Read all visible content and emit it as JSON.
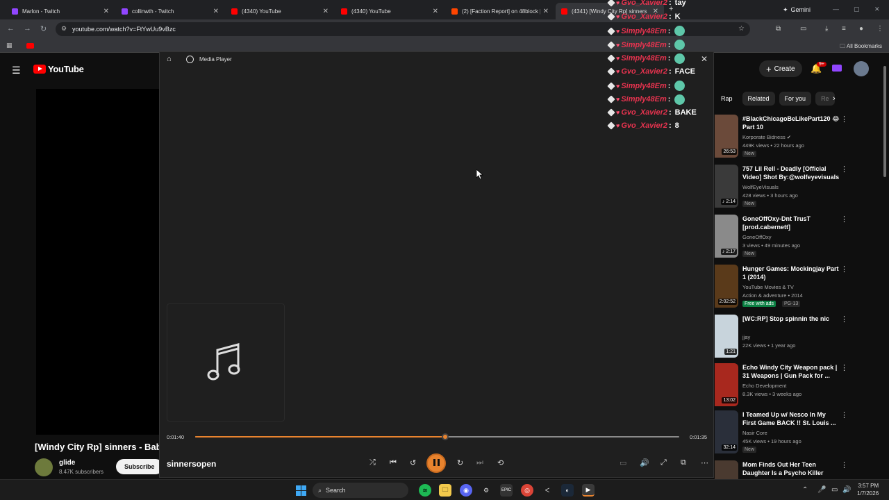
{
  "browser": {
    "tabs": [
      {
        "label": "Marlon - Twitch",
        "icon": "twitch-icon",
        "color": "#9146ff"
      },
      {
        "label": "collinwth - Twitch",
        "icon": "twitch-icon",
        "color": "#9146ff"
      },
      {
        "label": "(4340) YouTube",
        "icon": "youtube-icon",
        "color": "#ff0000"
      },
      {
        "label": "(4340) YouTube",
        "icon": "youtube-icon",
        "color": "#ff0000"
      },
      {
        "label": "(2) [Faction Report] on 48block |",
        "icon": "reddit-icon",
        "color": "#ff4500"
      },
      {
        "label": "(4341) [Windy City Rp] sinners",
        "icon": "youtube-icon",
        "color": "#ff0000"
      }
    ],
    "new_tab": "+",
    "gemini_label": "Gemini",
    "url": "youtube.com/watch?v=FtYwUu9vBzc",
    "all_bookmarks": "All Bookmarks"
  },
  "youtube": {
    "logo_text": "YouTube",
    "create_label": "Create",
    "notif_count": "9+",
    "video_title": "[Windy City Rp] sinners - Baby",
    "channel_name": "glide",
    "channel_subs": "8.47K subscribers",
    "subscribe_label": "Subscribe",
    "chips": [
      "Rap",
      "Related",
      "For you",
      "Re"
    ],
    "recommendations": [
      {
        "title": "#BlackChicagoBeLikePart120 😂 Part 10",
        "channel": "Korporate Bidness ✔",
        "meta": "449K views • 22 hours ago",
        "badge": "New",
        "duration": "26:53",
        "thumb": "#6b4a3a"
      },
      {
        "title": "757 Lil Rell - Deadly [Official Video] Shot By:@wolfeyevisuals",
        "channel": "WolfEyeVisuals",
        "meta": "428 views • 3 hours ago",
        "badge": "New",
        "duration": "♪ 2:14",
        "thumb": "#3a3a3a"
      },
      {
        "title": "GoneOffOxy-Dnt TrusT [prod.cabernett]",
        "channel": "GoneOffOxy",
        "meta": "3 views • 49 minutes ago",
        "badge": "New",
        "duration": "♪ 2:17",
        "thumb": "#8a8a8a"
      },
      {
        "title": "Hunger Games: Mockingjay Part 1 (2014)",
        "channel": "YouTube Movies & TV",
        "meta": "Action & adventure • 2014",
        "badge": "Free with ads",
        "badge2": "PG-13",
        "duration": "2:02:52",
        "thumb": "#5a3a1a"
      },
      {
        "title": "[WC:RP] Stop spinnin the nic",
        "channel": "jjay",
        "meta": "22K views • 1 year ago",
        "badge": "",
        "duration": "1:21",
        "thumb": "#c8d4dc"
      },
      {
        "title": "Echo Windy City Weapon pack | 31 Weapons | Gun Pack for ...",
        "channel": "Echo Development",
        "meta": "8.3K views • 3 weeks ago",
        "badge": "",
        "duration": "13:02",
        "thumb": "#a8281e"
      },
      {
        "title": "I Teamed Up w/ Nesco In My First Game BACK !! St. Louis ...",
        "channel": "Nasir Core",
        "meta": "45K views • 19 hours ago",
        "badge": "New",
        "duration": "32:14",
        "thumb": "#2a2f3a"
      },
      {
        "title": "Mom Finds Out Her Teen Daughter Is a Psycho Killer",
        "channel": "",
        "meta": "",
        "badge": "",
        "duration": "",
        "thumb": "#4a3a30"
      }
    ]
  },
  "media_player": {
    "app_title": "Media Player",
    "time_elapsed": "0:01:40",
    "time_total": "0:01:35",
    "progress_fraction": 0.516,
    "track_name": "sinnersopen"
  },
  "chat": [
    {
      "name": "Gvo_Xavier2",
      "msg": "tay",
      "emote": false
    },
    {
      "name": "Gvo_Xavier2",
      "msg": "K",
      "emote": false
    },
    {
      "name": "Simply48Em",
      "msg": "",
      "emote": true
    },
    {
      "name": "Simply48Em",
      "msg": "",
      "emote": true
    },
    {
      "name": "Simply48Em",
      "msg": "",
      "emote": true
    },
    {
      "name": "Gvo_Xavier2",
      "msg": "FACE",
      "emote": false
    },
    {
      "name": "Simply48Em",
      "msg": "",
      "emote": true
    },
    {
      "name": "Simply48Em",
      "msg": "",
      "emote": true
    },
    {
      "name": "Gvo_Xavier2",
      "msg": "BAKE",
      "emote": false
    },
    {
      "name": "Gvo_Xavier2",
      "msg": "8",
      "emote": false
    }
  ],
  "taskbar": {
    "search_label": "Search",
    "time": "3:57 PM",
    "date": "1/7/2026"
  }
}
